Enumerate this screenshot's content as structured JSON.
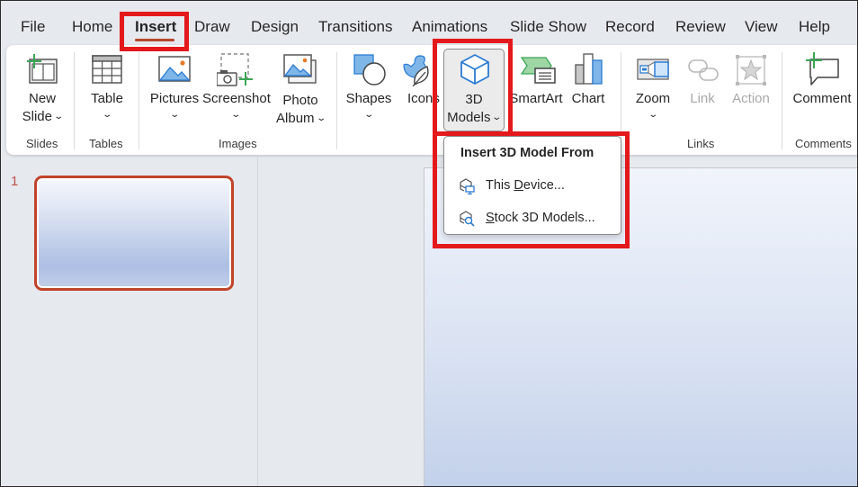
{
  "menu_tabs": [
    {
      "label": "File"
    },
    {
      "label": "Home"
    },
    {
      "label": "Insert",
      "active": true
    },
    {
      "label": "Draw"
    },
    {
      "label": "Design"
    },
    {
      "label": "Transitions"
    },
    {
      "label": "Animations"
    },
    {
      "label": "Slide Show"
    },
    {
      "label": "Record"
    },
    {
      "label": "Review"
    },
    {
      "label": "View"
    },
    {
      "label": "Help"
    }
  ],
  "ribbon": {
    "groups": {
      "slides": "Slides",
      "tables": "Tables",
      "images": "Images",
      "links": "Links",
      "comments": "Comments"
    },
    "buttons": {
      "new_slide": {
        "line1": "New",
        "line2": "Slide",
        "icon": "new-slide-icon"
      },
      "table": {
        "line1": "Table",
        "icon": "table-icon"
      },
      "pictures": {
        "line1": "Pictures",
        "icon": "pictures-icon"
      },
      "screenshot": {
        "line1": "Screenshot",
        "icon": "screenshot-icon"
      },
      "photo_album": {
        "line1": "Photo",
        "line2": "Album",
        "icon": "photo-album-icon"
      },
      "shapes": {
        "line1": "Shapes",
        "icon": "shapes-icon"
      },
      "icons": {
        "line1": "Icons",
        "icon": "icons-icon"
      },
      "models_3d": {
        "line1": "3D",
        "line2": "Models",
        "icon": "3d-cube-icon"
      },
      "smartart": {
        "line1": "SmartArt",
        "icon": "smartart-icon"
      },
      "chart": {
        "line1": "Chart",
        "icon": "chart-icon"
      },
      "zoom": {
        "line1": "Zoom",
        "icon": "zoom-icon"
      },
      "link": {
        "line1": "Link",
        "icon": "link-icon",
        "disabled": true
      },
      "action": {
        "line1": "Action",
        "icon": "action-star-icon",
        "disabled": true
      },
      "comment": {
        "line1": "Comment",
        "icon": "comment-icon"
      }
    },
    "chevron": "⌄"
  },
  "dropdown": {
    "title": "Insert 3D Model From",
    "items": [
      {
        "pre": "This ",
        "accel": "D",
        "post": "evice...",
        "icon": "device-3d-icon"
      },
      {
        "pre": "",
        "accel": "S",
        "post": "tock 3D Models...",
        "icon": "stock-3d-search-icon"
      }
    ]
  },
  "slide_panel": {
    "thumbnails": [
      {
        "number": "1",
        "selected": true
      }
    ]
  },
  "colors": {
    "accent": "#b7472a",
    "highlight": "#e3191c",
    "icon_blue": "#2b7cd3",
    "icon_green": "#3aa655"
  }
}
